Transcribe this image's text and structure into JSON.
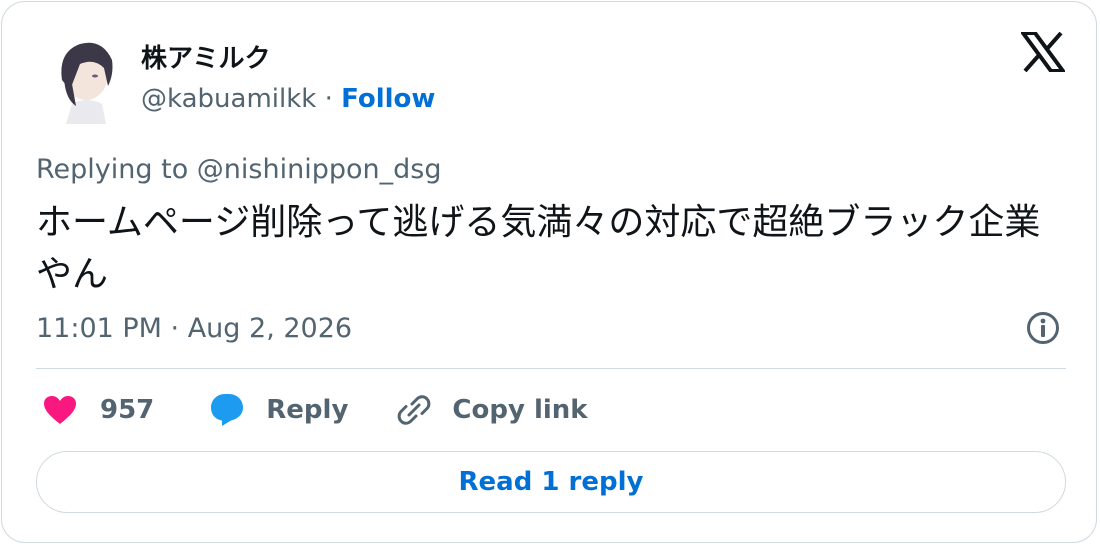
{
  "author": {
    "display_name": "株アミルク",
    "handle": "@kabuamilkk",
    "separator": "·",
    "follow_label": "Follow"
  },
  "reply_context": "Replying to @nishinippon_dsg",
  "tweet": {
    "text": "ホームページ削除って逃げる気満々の対応で超絶ブラック企業やん",
    "timestamp": "11:01 PM · Aug 2, 2026"
  },
  "actions": {
    "like_count": "957",
    "reply_label": "Reply",
    "copy_link_label": "Copy link"
  },
  "read_replies_label": "Read 1 reply",
  "colors": {
    "like": "#f91880",
    "reply": "#1d9bf0",
    "link": "#006fd6",
    "muted": "#536471"
  }
}
